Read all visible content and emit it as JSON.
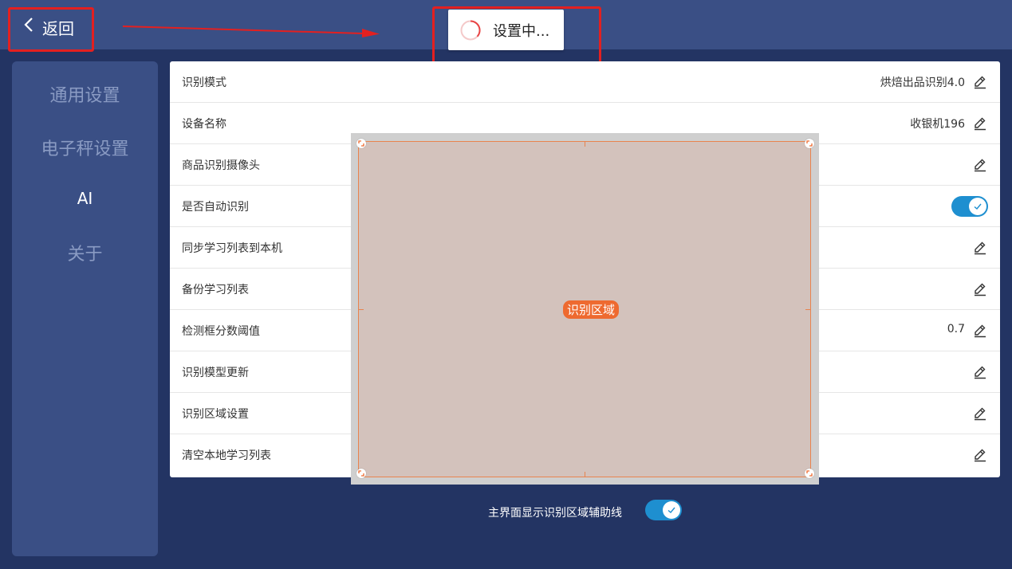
{
  "header": {
    "back_label": "返回",
    "toast_text": "设置中..."
  },
  "sidebar": {
    "items": [
      {
        "label": "通用设置",
        "active": false
      },
      {
        "label": "电子秤设置",
        "active": false
      },
      {
        "label": "AI",
        "active": true
      },
      {
        "label": "关于",
        "active": false
      }
    ]
  },
  "settings": [
    {
      "label": "识别模式",
      "value": "烘焙出品识别4.0",
      "control": "edit"
    },
    {
      "label": "设备名称",
      "value": "收银机196",
      "control": "edit"
    },
    {
      "label": "商品识别摄像头",
      "value": "",
      "control": "edit"
    },
    {
      "label": "是否自动识别",
      "value": "",
      "control": "toggle",
      "on": true
    },
    {
      "label": "同步学习列表到本机",
      "value": "",
      "control": "edit"
    },
    {
      "label": "备份学习列表",
      "value": "",
      "control": "edit"
    },
    {
      "label": "检测框分数阈值",
      "value": "0.7",
      "control": "edit"
    },
    {
      "label": "识别模型更新",
      "value": "",
      "control": "edit"
    },
    {
      "label": "识别区域设置",
      "value": "",
      "control": "edit"
    },
    {
      "label": "清空本地学习列表",
      "value": "",
      "control": "edit"
    }
  ],
  "overlay": {
    "area_label": "识别区域"
  },
  "footer": {
    "guide_label": "主界面显示识别区域辅助线",
    "guide_on": true
  },
  "colors": {
    "accent": "#1e8fd0",
    "annotation_red": "#e32020",
    "area_orange": "#ee6a30",
    "background": "#233463",
    "sidebar_bg": "#3a4f85"
  },
  "icons": [
    "chevron-left-icon",
    "spinner-icon",
    "pencil-icon",
    "check-icon",
    "resize-handle-icon"
  ]
}
